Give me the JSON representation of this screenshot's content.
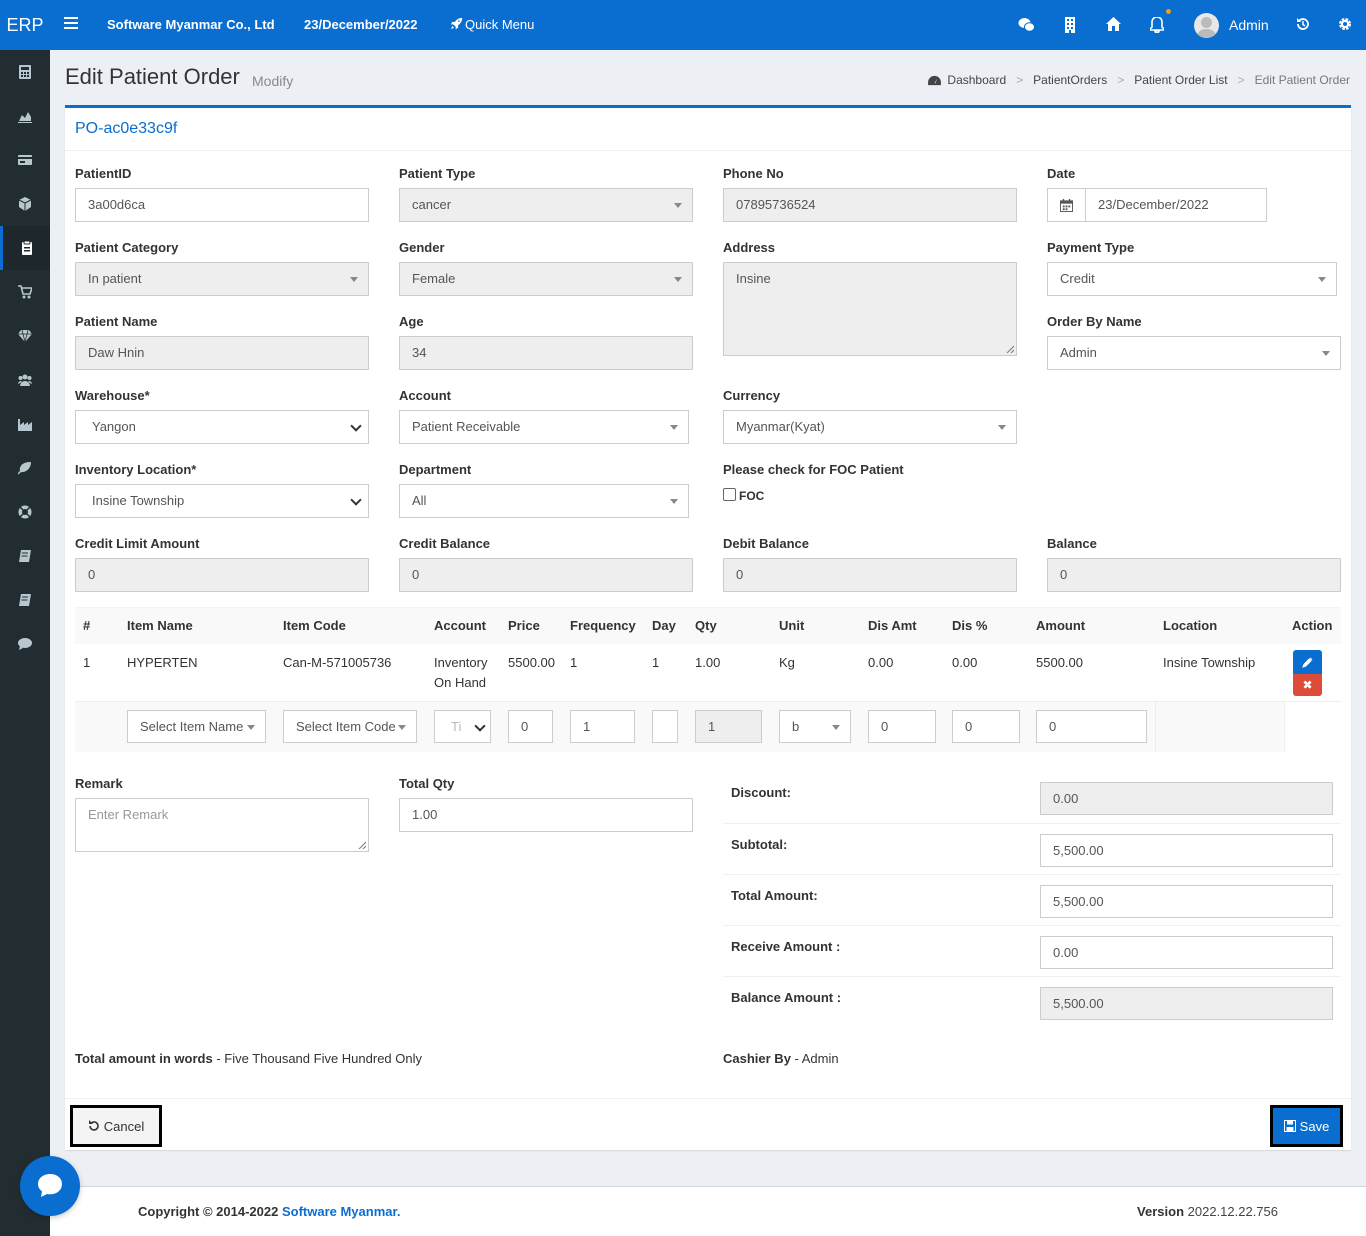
{
  "topbar": {
    "logo": "ERP",
    "company": "Software Myanmar Co., Ltd",
    "date": "23/December/2022",
    "quick_menu": "Quick Menu",
    "user": "Admin",
    "brand_color": "#0a6ed1"
  },
  "sidebar": {
    "icons": [
      "calculator-icon",
      "area-chart-icon",
      "credit-card-icon",
      "cube-icon",
      "clipboard-icon",
      "cart-icon",
      "diamond-icon",
      "users-icon",
      "industry-icon",
      "leaf-icon",
      "life-ring-icon",
      "book-icon",
      "book-icon",
      "comment-icon"
    ],
    "active_index": 4
  },
  "page": {
    "title": "Edit Patient Order",
    "subtitle": "Modify",
    "breadcrumb": [
      "Dashboard",
      "PatientOrders",
      "Patient Order List",
      "Edit Patient Order"
    ]
  },
  "order": {
    "number": "PO-ac0e33c9f"
  },
  "form": {
    "patient_id_label": "PatientID",
    "patient_id": "3a00d6ca",
    "patient_type_label": "Patient Type",
    "patient_type": "cancer",
    "phone_label": "Phone No",
    "phone": "07895736524",
    "date_label": "Date",
    "date": "23/December/2022",
    "category_label": "Patient Category",
    "category": "In patient",
    "gender_label": "Gender",
    "gender": "Female",
    "address_label": "Address",
    "address": "Insine",
    "payment_type_label": "Payment Type",
    "payment_type": "Credit",
    "name_label": "Patient Name",
    "name": "Daw Hnin",
    "age_label": "Age",
    "age": "34",
    "order_by_label": "Order By Name",
    "order_by": "Admin",
    "warehouse_label": "Warehouse*",
    "warehouse": "Yangon",
    "account_label": "Account",
    "account": "Patient Receivable",
    "currency_label": "Currency",
    "currency": "Myanmar(Kyat)",
    "inv_location_label": "Inventory Location*",
    "inv_location": "Insine Township",
    "department_label": "Department",
    "department": "All",
    "foc_label": "Please check for FOC Patient",
    "foc_checkbox": "FOC",
    "credit_limit_label": "Credit Limit Amount",
    "credit_limit": "0",
    "credit_balance_label": "Credit Balance",
    "credit_balance": "0",
    "debit_balance_label": "Debit Balance",
    "debit_balance": "0",
    "balance_label": "Balance",
    "balance": "0"
  },
  "table": {
    "headers": [
      "#",
      "Item Name",
      "Item Code",
      "Account",
      "Price",
      "Frequency",
      "Day",
      "Qty",
      "Unit",
      "Dis Amt",
      "Dis %",
      "Amount",
      "Location",
      "Action"
    ],
    "rows": [
      {
        "no": "1",
        "item_name": "HYPERTEN",
        "item_code": "Can-M-571005736",
        "account_1": "Inventory",
        "account_2": "On Hand",
        "price": "5500.00",
        "frequency": "1",
        "day": "1",
        "qty": "1.00",
        "unit": "Kg",
        "dis_amt": "0.00",
        "dis_pct": "0.00",
        "amount": "5500.00",
        "location": "Insine Township"
      }
    ],
    "new_row": {
      "item_name": "Select Item Name",
      "item_code": "Select Item Code",
      "account": "Ti",
      "price": "0",
      "frequency": "1",
      "day": "",
      "qty": "1",
      "unit": "b",
      "dis_amt": "0",
      "dis_pct": "0",
      "amount": "0"
    }
  },
  "bottom": {
    "remark_label": "Remark",
    "remark_placeholder": "Enter Remark",
    "total_qty_label": "Total Qty",
    "total_qty": "1.00",
    "discount_label": "Discount:",
    "discount": "0.00",
    "subtotal_label": "Subtotal:",
    "subtotal": "5,500.00",
    "total_amount_label": "Total Amount:",
    "total_amount": "5,500.00",
    "receive_label": "Receive Amount :",
    "receive": "0.00",
    "balance_amount_label": "Balance Amount :",
    "balance_amount": "5,500.00",
    "words_label": "Total amount in words",
    "words_value": " - Five Thousand Five Hundred Only",
    "cashier_label": "Cashier By",
    "cashier_value": " - Admin"
  },
  "actions": {
    "cancel": "Cancel",
    "save": "Save"
  },
  "footer": {
    "copyright": "Copyright © 2014-2022 ",
    "company_link": "Software Myanmar.",
    "version_label": "Version",
    "version": " 2022.12.22.756"
  }
}
